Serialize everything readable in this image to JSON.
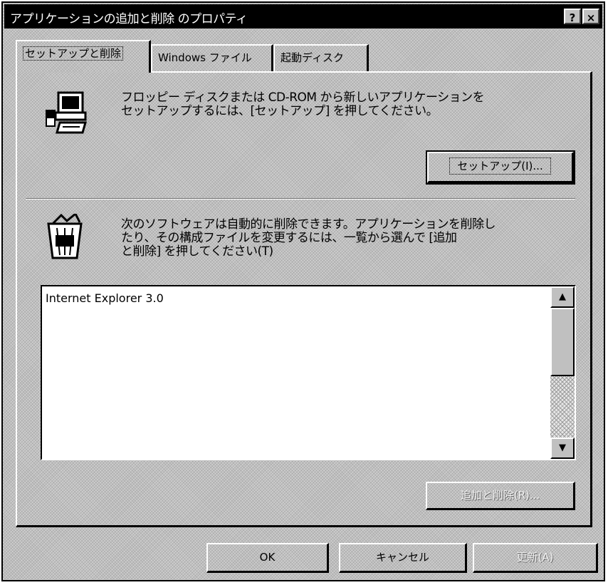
{
  "window": {
    "title": "アプリケーションの追加と削除 のプロパティ",
    "help_icon": "?",
    "close_icon": "×"
  },
  "tabs": [
    {
      "label": "セットアップと削除",
      "active": true
    },
    {
      "label": "Windows ファイル",
      "active": false
    },
    {
      "label": "起動ディスク",
      "active": false
    }
  ],
  "setup_section": {
    "icon": "setup-computer-icon",
    "description_line1": "フロッピー ディスクまたは CD-ROM から新しいアプリケーションを",
    "description_line2": "セットアップするには、[セットアップ] を押してください。",
    "setup_button_label": "セットアップ(I)..."
  },
  "remove_section": {
    "icon": "recycle-bin-icon",
    "description_line1": "次のソフトウェアは自動的に削除できます。アプリケーションを削除し",
    "description_line2": "たり、その構成ファイルを変更するには、一覧から選んで [追加",
    "description_line3": "と削除] を押してください(T)",
    "list_items": [
      "Internet Explorer 3.0"
    ],
    "add_remove_button_label": "追加と削除(R)..."
  },
  "dialog_buttons": {
    "ok_label": "OK",
    "cancel_label": "キャンセル",
    "apply_label": "更新(A)"
  }
}
